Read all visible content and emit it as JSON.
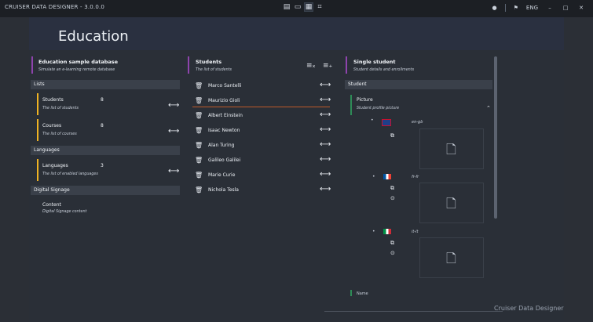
{
  "window": {
    "title": "CRUISER DATA DESIGNER - 3.0.0.0",
    "language": "ENG",
    "min": "–",
    "max": "□",
    "close": "✕"
  },
  "page": {
    "title": "Education"
  },
  "database": {
    "title": "Education sample database",
    "subtitle": "Simulate an e-learning remote database"
  },
  "sections": {
    "lists": "Lists",
    "languages": "Languages",
    "signage": "Digital Signage"
  },
  "lists": [
    {
      "label": "Students",
      "count": "8",
      "sub": "The list of students"
    },
    {
      "label": "Courses",
      "count": "8",
      "sub": "The list of courses"
    }
  ],
  "languages_item": {
    "label": "Languages",
    "count": "3",
    "sub": "The list of enabled languages"
  },
  "signage": {
    "label": "Content",
    "sub": "Digital Signage content"
  },
  "students": {
    "title": "Students",
    "subtitle": "The list of students",
    "names": [
      "Marco Santelli",
      "Maurizio Gioli",
      "Albert Einstein",
      "Isaac Newton",
      "Alan Turing",
      "Galileo Galilei",
      "Marie Curie",
      "Nichola Tesla"
    ]
  },
  "single": {
    "title": "Single student",
    "subtitle": "Student details and enrollments",
    "section": "Student",
    "picture": {
      "label": "Picture",
      "sub": "Student profile picture"
    },
    "languages": [
      "en-gb",
      "fr-fr",
      "it-it"
    ],
    "next_label": "Name"
  },
  "footer": {
    "brand": "Cruiser Data Designer"
  },
  "colors": {
    "accent_purple": "#8e44ad",
    "accent_yellow": "#f0b323",
    "accent_green": "#2e8b57",
    "underline": "#c05a2a"
  }
}
